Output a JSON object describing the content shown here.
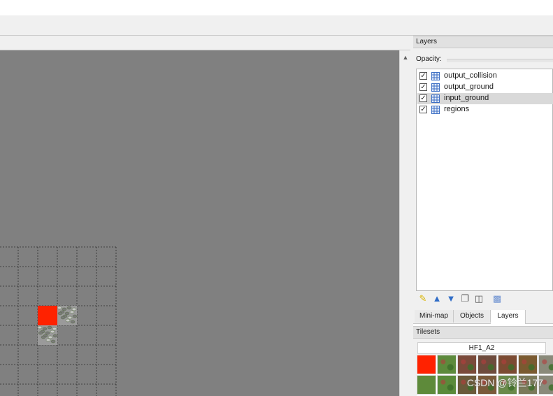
{
  "layers_panel": {
    "title": "Layers",
    "opacity_label": "Opacity:",
    "layers": [
      {
        "name": "output_collision",
        "visible": true,
        "selected": false
      },
      {
        "name": "output_ground",
        "visible": true,
        "selected": false
      },
      {
        "name": "input_ground",
        "visible": true,
        "selected": true
      },
      {
        "name": "regions",
        "visible": true,
        "selected": false
      }
    ],
    "tools": [
      "new-layer-icon",
      "raise-layer-icon",
      "lower-layer-icon",
      "duplicate-layer-icon",
      "delete-layer-icon",
      "toggle-other-layers-icon"
    ]
  },
  "tabs": [
    {
      "label": "Mini-map",
      "active": false
    },
    {
      "label": "Objects",
      "active": false
    },
    {
      "label": "Layers",
      "active": true
    }
  ],
  "tilesets_panel": {
    "title": "Tilesets",
    "tileset_name": "HF1_A2",
    "tiles_row1": [
      "#ff2200",
      "#5d8a3c",
      "#7a4a3a",
      "#6e4b3c",
      "#7b4b32",
      "#7a5a30",
      "#8a8a7a"
    ],
    "tiles_row2": [
      "#5e8a3a",
      "#5a8a3a",
      "#6a5a3a",
      "#7a5a3a",
      "#6a8a4a",
      "#7b7a5a",
      "#8a8a7a"
    ]
  },
  "canvas": {
    "background": "#808080",
    "red_tile_color": "#ff2200",
    "cobble_color": "#9a9a9a"
  },
  "watermark": "CSDN @铃兰177"
}
